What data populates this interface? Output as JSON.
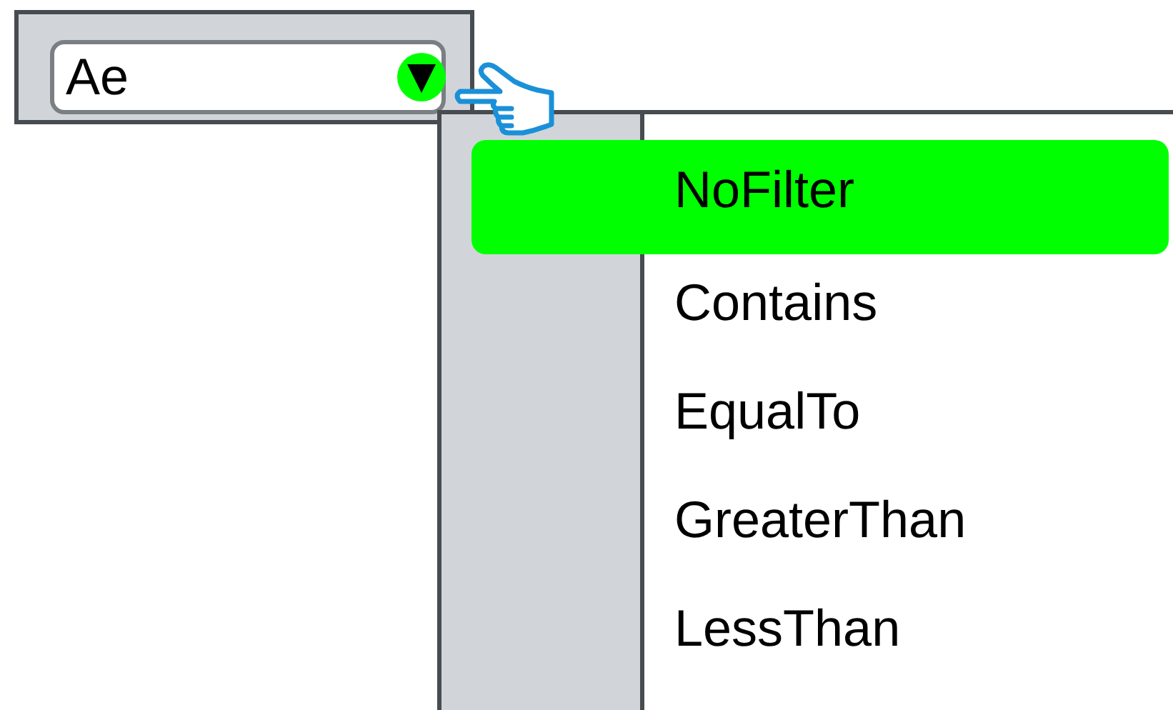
{
  "filter_field": {
    "value": "Ae"
  },
  "options": [
    {
      "label": "NoFilter",
      "selected": true
    },
    {
      "label": "Contains",
      "selected": false
    },
    {
      "label": "EqualTo",
      "selected": false
    },
    {
      "label": "GreaterThan",
      "selected": false
    },
    {
      "label": "LessThan",
      "selected": false
    }
  ]
}
